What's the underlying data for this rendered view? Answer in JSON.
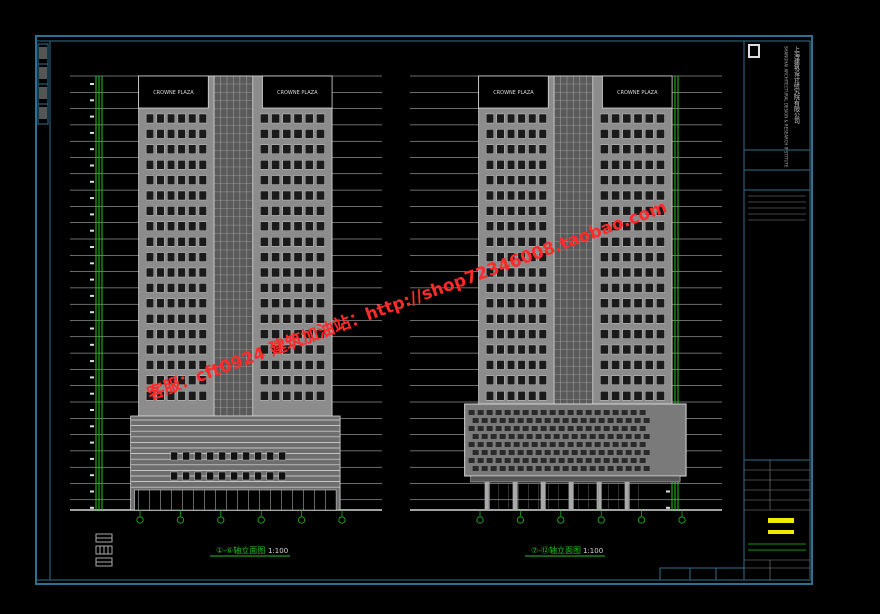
{
  "drawing": {
    "background": "#000000",
    "frame_color": "#2f6f8f",
    "line_color": "#d8d8d8",
    "facade_fill": "#8c8c8c",
    "grid_color": "#22c422",
    "accent_yellow": "#f2ea00"
  },
  "elevations": [
    {
      "id": "left",
      "title": "①-⑥轴立面图",
      "scale": "1:100",
      "brand": "CROWNE PLAZA"
    },
    {
      "id": "right",
      "title": "⑦-⑫轴立面图",
      "scale": "1:100",
      "brand": "CROWNE PLAZA"
    }
  ],
  "watermark": {
    "line1": "客服：cft0924 建筑加油站：http://shop72346008.taobao.com",
    "color": "#ff2a2a"
  },
  "title_block": {
    "company": "上海建筑设计研究院有限公司",
    "company_en": "SHANGHAI ARCHITECTURAL DESIGN & RESEARCH INSTITUTE"
  }
}
